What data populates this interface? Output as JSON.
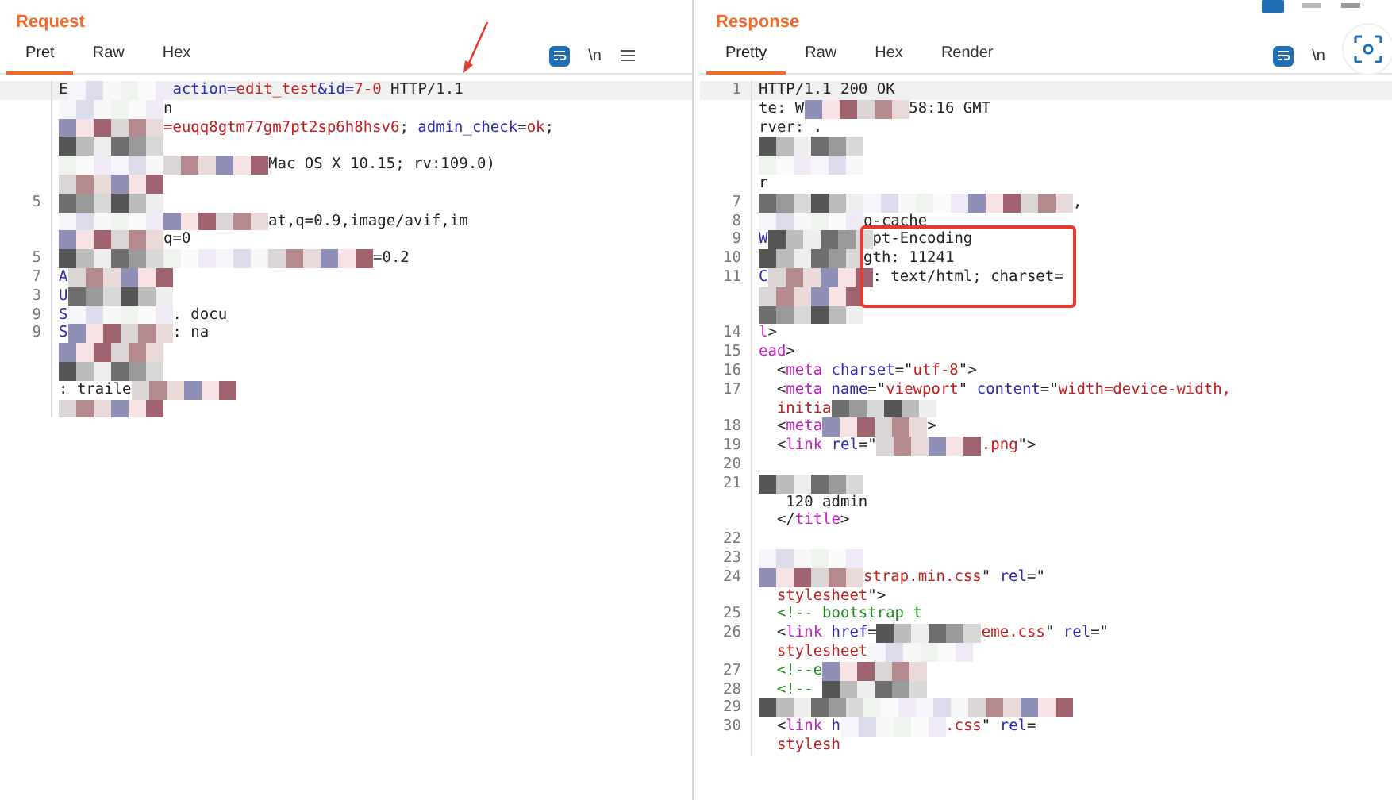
{
  "request": {
    "title": "Request",
    "tabs": [
      {
        "label": "Pret",
        "selected": true
      },
      {
        "label": "Raw",
        "selected": false
      },
      {
        "label": "Hex",
        "selected": false
      }
    ],
    "wrap_icon_label": "\\n",
    "lines": [
      {
        "segments": [
          {
            "kind": "plain",
            "text": "E"
          },
          {
            "kind": "redacted"
          },
          {
            "kind": "key",
            "text": "action="
          },
          {
            "kind": "value",
            "text": "edit_test"
          },
          {
            "kind": "key",
            "text": "&id="
          },
          {
            "kind": "value",
            "text": "7-0"
          },
          {
            "kind": "plain",
            "text": " HTTP/1.1"
          }
        ]
      },
      {
        "segments": [
          {
            "kind": "redacted"
          },
          {
            "kind": "plain",
            "text": "n"
          }
        ]
      },
      {
        "segments": [
          {
            "kind": "redacted"
          },
          {
            "kind": "value",
            "text": "=euqq8gtm77gm7pt2sp6h8hsv6"
          },
          {
            "kind": "plain",
            "text": "; "
          },
          {
            "kind": "key",
            "text": "admin_check"
          },
          {
            "kind": "plain",
            "text": "="
          },
          {
            "kind": "value",
            "text": "ok"
          },
          {
            "kind": "plain",
            "text": ";"
          }
        ]
      },
      {
        "segments": [
          {
            "kind": "redacted"
          }
        ]
      },
      {
        "segments": [
          {
            "kind": "redacted"
          },
          {
            "kind": "redacted"
          },
          {
            "kind": "plain",
            "text": "Mac OS X 10.15; rv:109.0)"
          }
        ]
      },
      {
        "segments": [
          {
            "kind": "redacted"
          }
        ]
      },
      {
        "number": "5",
        "segments": [
          {
            "kind": "redacted"
          }
        ]
      },
      {
        "segments": [
          {
            "kind": "redacted"
          },
          {
            "kind": "redacted"
          },
          {
            "kind": "plain",
            "text": "at"
          },
          {
            "kind": "plain",
            "text": ",q=0.9,image/avif,im"
          }
        ]
      },
      {
        "segments": [
          {
            "kind": "redacted"
          },
          {
            "kind": "plain",
            "text": "q=0"
          }
        ]
      },
      {
        "number": "5",
        "segments": [
          {
            "kind": "redacted"
          },
          {
            "kind": "redacted"
          },
          {
            "kind": "redacted"
          },
          {
            "kind": "plain",
            "text": "=0.2"
          }
        ]
      },
      {
        "number": "7",
        "segments": [
          {
            "kind": "key",
            "text": "A"
          },
          {
            "kind": "redacted"
          }
        ]
      },
      {
        "number": "3",
        "segments": [
          {
            "kind": "key",
            "text": "U"
          },
          {
            "kind": "redacted"
          }
        ]
      },
      {
        "number": "9",
        "segments": [
          {
            "kind": "key",
            "text": "S"
          },
          {
            "kind": "redacted"
          },
          {
            "kind": "plain",
            "text": ". docu"
          }
        ]
      },
      {
        "number": "9",
        "segments": [
          {
            "kind": "key",
            "text": "S"
          },
          {
            "kind": "redacted"
          },
          {
            "kind": "plain",
            "text": ": na"
          }
        ]
      },
      {
        "segments": [
          {
            "kind": "redacted"
          }
        ]
      },
      {
        "segments": [
          {
            "kind": "redacted"
          }
        ]
      },
      {
        "segments": [
          {
            "kind": "plain",
            "text": ": traile"
          },
          {
            "kind": "redacted"
          }
        ]
      },
      {
        "segments": [
          {
            "kind": "redacted"
          }
        ]
      }
    ]
  },
  "response": {
    "title": "Response",
    "tabs": [
      {
        "label": "Pretty",
        "selected": true
      },
      {
        "label": "Raw",
        "selected": false
      },
      {
        "label": "Hex",
        "selected": false
      },
      {
        "label": "Render",
        "selected": false
      }
    ],
    "wrap_icon_label": "\\n",
    "lines": [
      {
        "number": "1",
        "segments": [
          {
            "kind": "plain",
            "text": "HTTP/1.1 200 OK"
          }
        ]
      },
      {
        "segments": [
          {
            "kind": "plain",
            "text": "te: W"
          },
          {
            "kind": "redacted"
          },
          {
            "kind": "plain",
            "text": "58:16 GMT"
          }
        ]
      },
      {
        "segments": [
          {
            "kind": "plain",
            "text": "rver: ."
          }
        ]
      },
      {
        "segments": [
          {
            "kind": "redacted"
          }
        ]
      },
      {
        "segments": [
          {
            "kind": "redacted"
          }
        ]
      },
      {
        "segments": [
          {
            "kind": "plain",
            "text": "r"
          }
        ]
      },
      {
        "number": "7",
        "segments": [
          {
            "kind": "redacted"
          },
          {
            "kind": "redacted"
          },
          {
            "kind": "redacted"
          },
          {
            "kind": "plain",
            "text": ","
          }
        ]
      },
      {
        "number": "8",
        "segments": [
          {
            "kind": "redacted"
          },
          {
            "kind": "plain",
            "text": "o-cache"
          }
        ]
      },
      {
        "number": "9",
        "segments": [
          {
            "kind": "key",
            "text": "W"
          },
          {
            "kind": "redacted"
          },
          {
            "kind": "plain",
            "text": "pt-Encoding"
          }
        ]
      },
      {
        "number": "10",
        "segments": [
          {
            "kind": "redacted"
          },
          {
            "kind": "plain",
            "text": "gth: 11241"
          }
        ]
      },
      {
        "number": "11",
        "segments": [
          {
            "kind": "key",
            "text": "C"
          },
          {
            "kind": "redacted"
          },
          {
            "kind": "plain",
            "text": ": text/html; charset="
          }
        ]
      },
      {
        "segments": [
          {
            "kind": "redacted"
          }
        ]
      },
      {
        "segments": [
          {
            "kind": "redacted"
          }
        ]
      },
      {
        "number": "14",
        "segments": [
          {
            "kind": "tag",
            "text": "l"
          },
          {
            "kind": "plain",
            "text": ">"
          }
        ]
      },
      {
        "number": "15",
        "segments": [
          {
            "kind": "tag",
            "text": "ead"
          },
          {
            "kind": "plain",
            "text": ">"
          }
        ]
      },
      {
        "number": "16",
        "segments": [
          {
            "kind": "plain",
            "text": "  <"
          },
          {
            "kind": "tag",
            "text": "meta "
          },
          {
            "kind": "key",
            "text": "charset"
          },
          {
            "kind": "plain",
            "text": "=\""
          },
          {
            "kind": "value",
            "text": "utf-8"
          },
          {
            "kind": "plain",
            "text": "\">"
          }
        ]
      },
      {
        "number": "17",
        "segments": [
          {
            "kind": "plain",
            "text": "  <"
          },
          {
            "kind": "tag",
            "text": "meta "
          },
          {
            "kind": "key",
            "text": "name"
          },
          {
            "kind": "plain",
            "text": "=\""
          },
          {
            "kind": "value",
            "text": "viewport"
          },
          {
            "kind": "plain",
            "text": "\" "
          },
          {
            "kind": "key",
            "text": "content"
          },
          {
            "kind": "plain",
            "text": "=\""
          },
          {
            "kind": "value",
            "text": "width=device-width,"
          }
        ]
      },
      {
        "segments": [
          {
            "kind": "value",
            "text": "  initia"
          },
          {
            "kind": "redacted"
          }
        ]
      },
      {
        "number": "18",
        "segments": [
          {
            "kind": "plain",
            "text": "  <"
          },
          {
            "kind": "tag",
            "text": "meta"
          },
          {
            "kind": "redacted"
          },
          {
            "kind": "plain",
            "text": ">"
          }
        ]
      },
      {
        "number": "19",
        "segments": [
          {
            "kind": "plain",
            "text": "  <"
          },
          {
            "kind": "tag",
            "text": "link "
          },
          {
            "kind": "key",
            "text": "rel"
          },
          {
            "kind": "plain",
            "text": "=\""
          },
          {
            "kind": "redacted"
          },
          {
            "kind": "value",
            "text": ".png"
          },
          {
            "kind": "plain",
            "text": "\">"
          }
        ]
      },
      {
        "number": "20"
      },
      {
        "number": "21",
        "segments": [
          {
            "kind": "redacted"
          }
        ]
      },
      {
        "segments": [
          {
            "kind": "plain",
            "text": "   120 admin"
          }
        ]
      },
      {
        "segments": [
          {
            "kind": "plain",
            "text": "  </"
          },
          {
            "kind": "tag",
            "text": "title"
          },
          {
            "kind": "plain",
            "text": ">"
          }
        ]
      },
      {
        "number": "22"
      },
      {
        "number": "23",
        "segments": [
          {
            "kind": "redacted"
          }
        ]
      },
      {
        "number": "24",
        "segments": [
          {
            "kind": "redacted"
          },
          {
            "kind": "value",
            "text": "strap.min.css"
          },
          {
            "kind": "plain",
            "text": "\" "
          },
          {
            "kind": "key",
            "text": "rel"
          },
          {
            "kind": "plain",
            "text": "=\""
          }
        ]
      },
      {
        "segments": [
          {
            "kind": "value",
            "text": "  stylesheet"
          },
          {
            "kind": "plain",
            "text": "\">"
          }
        ]
      },
      {
        "number": "25",
        "segments": [
          {
            "kind": "comment",
            "text": "  <!-- bootstrap t"
          }
        ]
      },
      {
        "number": "26",
        "segments": [
          {
            "kind": "plain",
            "text": "  <"
          },
          {
            "kind": "tag",
            "text": "link "
          },
          {
            "kind": "key",
            "text": "href"
          },
          {
            "kind": "plain",
            "text": "="
          },
          {
            "kind": "redacted"
          },
          {
            "kind": "value",
            "text": "eme.css"
          },
          {
            "kind": "plain",
            "text": "\" "
          },
          {
            "kind": "key",
            "text": "rel"
          },
          {
            "kind": "plain",
            "text": "=\""
          }
        ]
      },
      {
        "segments": [
          {
            "kind": "value",
            "text": "  stylesheet"
          },
          {
            "kind": "redacted"
          }
        ]
      },
      {
        "number": "27",
        "segments": [
          {
            "kind": "comment",
            "text": "  <!--e"
          },
          {
            "kind": "redacted"
          }
        ]
      },
      {
        "number": "28",
        "segments": [
          {
            "kind": "comment",
            "text": "  <!-- "
          },
          {
            "kind": "redacted"
          }
        ]
      },
      {
        "number": "29",
        "segments": [
          {
            "kind": "redacted"
          },
          {
            "kind": "redacted"
          },
          {
            "kind": "redacted"
          }
        ]
      },
      {
        "number": "30",
        "segments": [
          {
            "kind": "plain",
            "text": "  <"
          },
          {
            "kind": "tag",
            "text": "link "
          },
          {
            "kind": "key",
            "text": "h"
          },
          {
            "kind": "redacted"
          },
          {
            "kind": "value",
            "text": ".css"
          },
          {
            "kind": "plain",
            "text": "\" "
          },
          {
            "kind": "key",
            "text": "rel"
          },
          {
            "kind": "plain",
            "text": "="
          }
        ]
      },
      {
        "segments": [
          {
            "kind": "value",
            "text": "  stylesh"
          }
        ]
      }
    ]
  }
}
